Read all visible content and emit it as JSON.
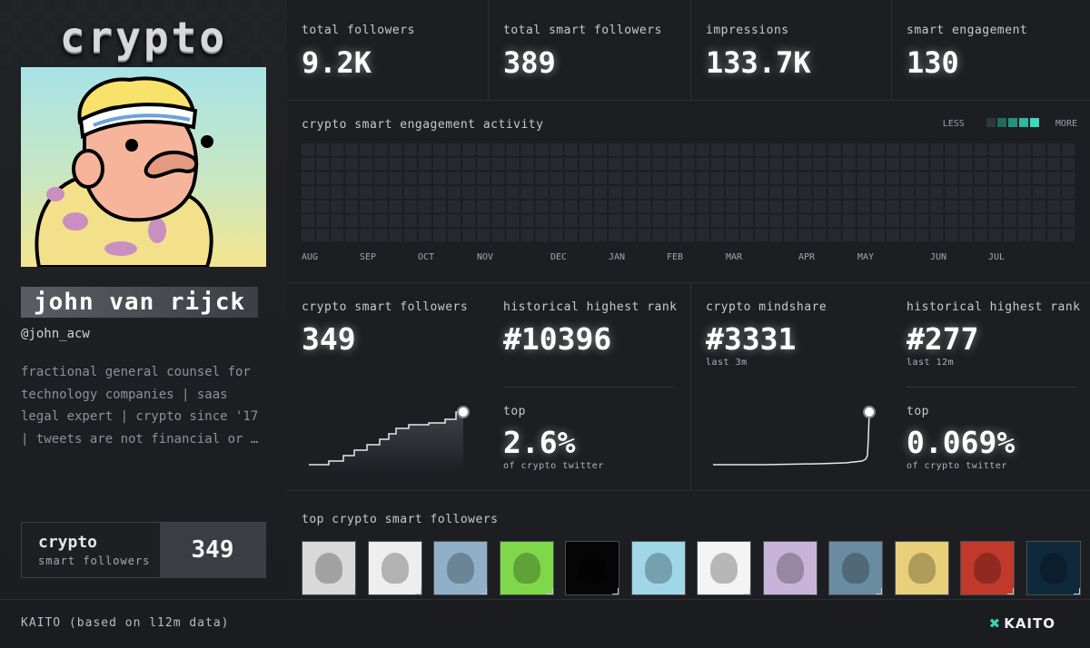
{
  "profile": {
    "brand": "crypto",
    "name": "john van rijck",
    "handle": "@john_acw",
    "bio": [
      "fractional general counsel for",
      "technology companies | saas",
      "legal expert | crypto since '17",
      "| tweets are not financial or …"
    ],
    "smart_followers_title": "crypto",
    "smart_followers_sub": "smart followers",
    "smart_followers_value": "349"
  },
  "stats": [
    {
      "label": "total followers",
      "value": "9.2K"
    },
    {
      "label": "total smart followers",
      "value": "389"
    },
    {
      "label": "impressions",
      "value": "133.7K"
    },
    {
      "label": "smart engagement",
      "value": "130"
    }
  ],
  "activity": {
    "title": "crypto smart engagement activity",
    "legend_less": "LESS",
    "legend_more": "MORE",
    "legend_colors": [
      "#2b3a38",
      "#1f6b5e",
      "#25927f",
      "#2fb79f",
      "#3fd8bd"
    ],
    "months": [
      "AUG",
      "SEP",
      "OCT",
      "NOV",
      "DEC",
      "JAN",
      "FEB",
      "MAR",
      "APR",
      "MAY",
      "JUN",
      "JUL"
    ],
    "cell_color": "#26292d"
  },
  "smart_followers_panel": {
    "label": "crypto smart followers",
    "value": "349",
    "rank_label": "historical highest rank",
    "rank_value": "#10396",
    "top_label": "top",
    "top_value": "2.6%",
    "top_sub": "of crypto twitter"
  },
  "mindshare_panel": {
    "label": "crypto mindshare",
    "value": "#3331",
    "value_sub": "last 3m",
    "rank_label": "historical highest rank",
    "rank_value": "#277",
    "rank_sub": "last 12m",
    "top_label": "top",
    "top_value": "0.069%",
    "top_sub": "of crypto twitter"
  },
  "followers_row": {
    "title": "top crypto smart followers",
    "avatars": [
      {
        "icon": "portrait-bw-icon",
        "bg": "#d9d9d9"
      },
      {
        "icon": "sketch-figure-icon",
        "bg": "#eeeeee"
      },
      {
        "icon": "family-photo-icon",
        "bg": "#8fb0c8"
      },
      {
        "icon": "duck-icon",
        "bg": "#7fd84a"
      },
      {
        "icon": "waveform-icon",
        "bg": "#050505"
      },
      {
        "icon": "ape-cap-icon",
        "bg": "#9fd6e8"
      },
      {
        "icon": "cartoon-boy-icon",
        "bg": "#f4f4f4"
      },
      {
        "icon": "ape-3d-glasses-icon",
        "bg": "#c8b4d8"
      },
      {
        "icon": "punk-pixel-icon",
        "bg": "#6a8ca0"
      },
      {
        "icon": "punk-striped-icon",
        "bg": "#e8d07a"
      },
      {
        "icon": "safari-hat-icon",
        "bg": "#c0392b"
      },
      {
        "icon": "skull-icon",
        "bg": "#0e2a3a"
      }
    ]
  },
  "footer": {
    "note": "KAITO (based on l12m data)",
    "logo": "KAITO"
  }
}
